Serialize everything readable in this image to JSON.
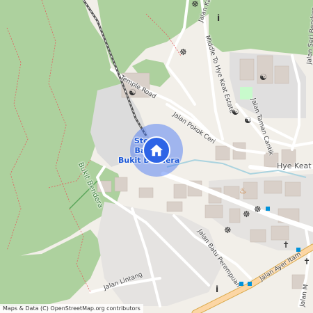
{
  "map": {
    "station_name": [
      "Stesen",
      "Bawah",
      "Bukit Bendera"
    ],
    "attribution": "Maps & Data (C) OpenStreetMap.org contributors",
    "labels": {
      "jalan_kam": "Jalan Kam",
      "middle_to_hye_keat": "Middle To Hye Keat Estate",
      "temple_road": "Temple Road",
      "jalan_pokok_ceri": "Jalan Pokok Ceri",
      "jalan_taman_cantik": "Jalan Taman Cantik",
      "jalan_seri_bendera": "Jalan Seri Bendera",
      "hye_keat": "Hye Keat",
      "bukit_bendera": "Bukit Bendera",
      "jalan_batu_perempuan": "Jalan Batu Perempuan",
      "jalan_ayer_itam": "Jalan Ayer Itam",
      "jalan_lintang": "Jalan Lintang",
      "jalan_m": "Jalan M"
    },
    "colors": {
      "forest": "#add19e",
      "park": "#c8facc",
      "residential": "#e0dfdf",
      "building": "#d9d0c9",
      "road_major": "#fcd6a4",
      "road_minor": "#ffffff",
      "location": "#2e64e6"
    },
    "icons": [
      "yin-yang-icon",
      "dharma-wheel-icon",
      "cross-icon",
      "info-icon",
      "fire-icon",
      "bus-stop-icon",
      "home-icon"
    ]
  }
}
